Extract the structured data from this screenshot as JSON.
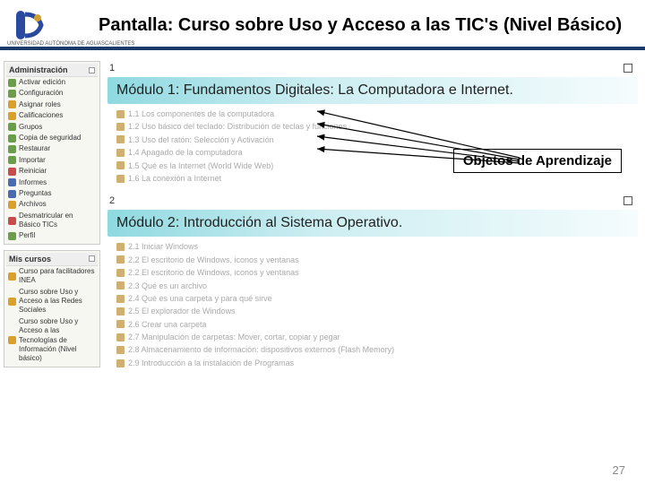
{
  "header": {
    "logo_caption": "UNIVERSIDAD AUTÓNOMA\nDE AGUASCALIENTES",
    "title": "Pantalla: Curso sobre Uso y Acceso a las TIC's (Nivel Básico)"
  },
  "sidebar": {
    "admin": {
      "head": "Administración",
      "items": [
        {
          "label": "Activar edición",
          "color": "#6b9e4a"
        },
        {
          "label": "Configuración",
          "color": "#6b9e4a"
        },
        {
          "label": "Asignar roles",
          "color": "#d9a02b"
        },
        {
          "label": "Calificaciones",
          "color": "#d9a02b"
        },
        {
          "label": "Grupos",
          "color": "#6b9e4a"
        },
        {
          "label": "Copia de seguridad",
          "color": "#6b9e4a"
        },
        {
          "label": "Restaurar",
          "color": "#6b9e4a"
        },
        {
          "label": "Importar",
          "color": "#6b9e4a"
        },
        {
          "label": "Reiniciar",
          "color": "#c94b4b"
        },
        {
          "label": "Informes",
          "color": "#4a6bb0"
        },
        {
          "label": "Preguntas",
          "color": "#4a6bb0"
        },
        {
          "label": "Archivos",
          "color": "#d9a02b"
        },
        {
          "label": "Desmatricular en Básico TICs",
          "color": "#c94b4b"
        },
        {
          "label": "Perfil",
          "color": "#6b9e4a"
        }
      ]
    },
    "courses": {
      "head": "Mis cursos",
      "items": [
        {
          "label": "Curso para facilitadores INEA"
        },
        {
          "label": "Curso sobre Uso y Acceso a las Redes Sociales"
        },
        {
          "label": "Curso sobre Uso y Acceso a las Tecnologías de Información (Nivel básico)"
        }
      ]
    }
  },
  "modules": [
    {
      "num": "1",
      "title": "Módulo 1: Fundamentos Digitales: La Computadora e Internet.",
      "items": [
        "1.1 Los componentes de la computadora",
        "1.2 Uso básico del teclado: Distribución de teclas y funciones",
        "1.3 Uso del ratón: Selección y Activación",
        "1.4 Apagado de la computadora",
        "1.5 Qué es la Internet (World Wide Web)",
        "1.6 La conexión a Internet"
      ]
    },
    {
      "num": "2",
      "title": "Módulo 2: Introducción al Sistema Operativo.",
      "items": [
        "2.1 Iniciar Windows",
        "2.2 El escritorio de Windows, iconos y ventanas",
        "2.2 El escritorio de Windows, iconos y ventanas",
        "2.3 Qué es un archivo",
        "2.4 Qué es una carpeta y para qué sirve",
        "2.5 El explorador de Windows",
        "2.6 Crear una carpeta",
        "2.7 Manipulación de carpetas: Mover, cortar, copiar y pegar",
        "2.8 Almacenamiento de información: dispositivos externos (Flash Memory)",
        "2.9 Introducción a la instalación de Programas"
      ]
    }
  ],
  "callout": "Objetos de Aprendizaje",
  "page_num": "27"
}
